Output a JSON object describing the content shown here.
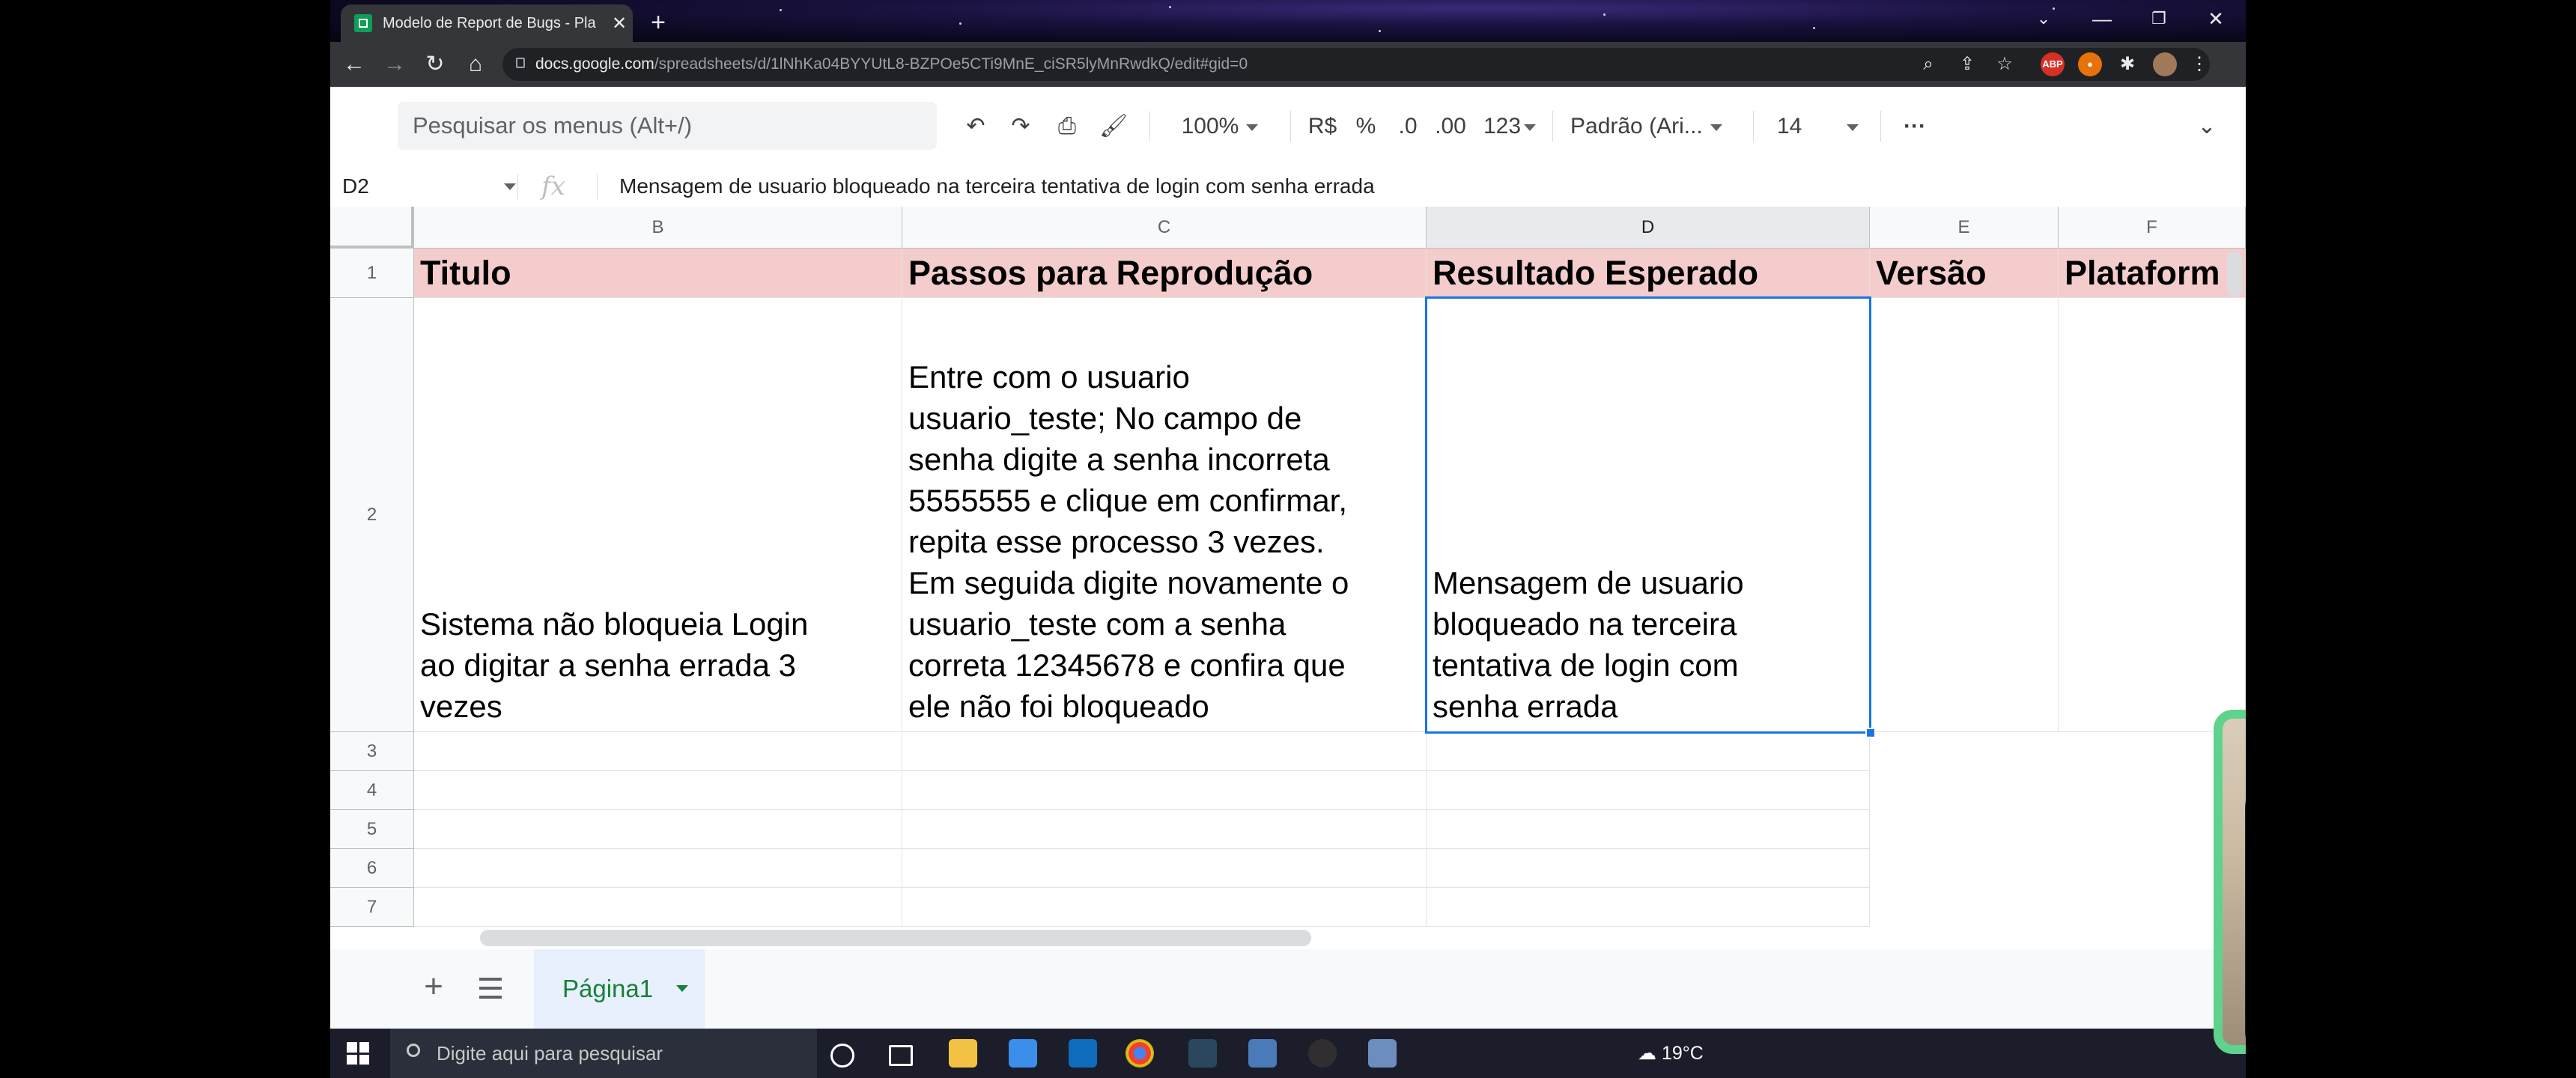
{
  "browser": {
    "tab_title": "Modelo de Report de Bugs - Pla",
    "url_domain": "docs.google.com",
    "url_path": "/spreadsheets/d/1lNhKa04BYYUtL8-BZPOe5CTi9MnE_ciSR5lyMnRwdkQ/edit#gid=0"
  },
  "sheets_toolbar": {
    "search_menus": "Pesquisar os menus (Alt+/)",
    "zoom": "100%",
    "currency": "R$",
    "percent": "%",
    "decrease_decimal": ".0",
    "increase_decimal": ".00",
    "more_formats": "123",
    "font": "Padrão (Ari...",
    "font_size": "14",
    "more": "···"
  },
  "formula_bar": {
    "cell_ref": "D2",
    "fx": "fx",
    "content": "Mensagem de usuario bloqueado na terceira tentativa de login com senha errada"
  },
  "columns": [
    "B",
    "C",
    "D",
    "E",
    "F"
  ],
  "rows": [
    "1",
    "2",
    "3",
    "4",
    "5",
    "6",
    "7"
  ],
  "headers": {
    "titulo": "Titulo",
    "passos": "Passos para Reprodução",
    "resultado": "Resultado Esperado",
    "versao": "Versão",
    "plataforma": "Plataform"
  },
  "row2": {
    "titulo": "Sistema não bloqueia Login\nao digitar a senha errada 3\nvezes",
    "passos": "Entre com o usuario\nusuario_teste; No campo de\nsenha digite a senha incorreta\n5555555 e clique em confirmar,\nrepita esse processo 3 vezes.\nEm seguida digite novamente o\nusuario_teste com a senha\ncorreta 12345678 e confira que\nele não foi bloqueado",
    "resultado": "Mensagem de usuario\nbloqueado na terceira\ntentativa de login com\nsenha errada"
  },
  "sheet_tabs": {
    "active": "Página1"
  },
  "taskbar": {
    "search_placeholder": "Digite aqui para pesquisar",
    "weather": "19°C"
  }
}
